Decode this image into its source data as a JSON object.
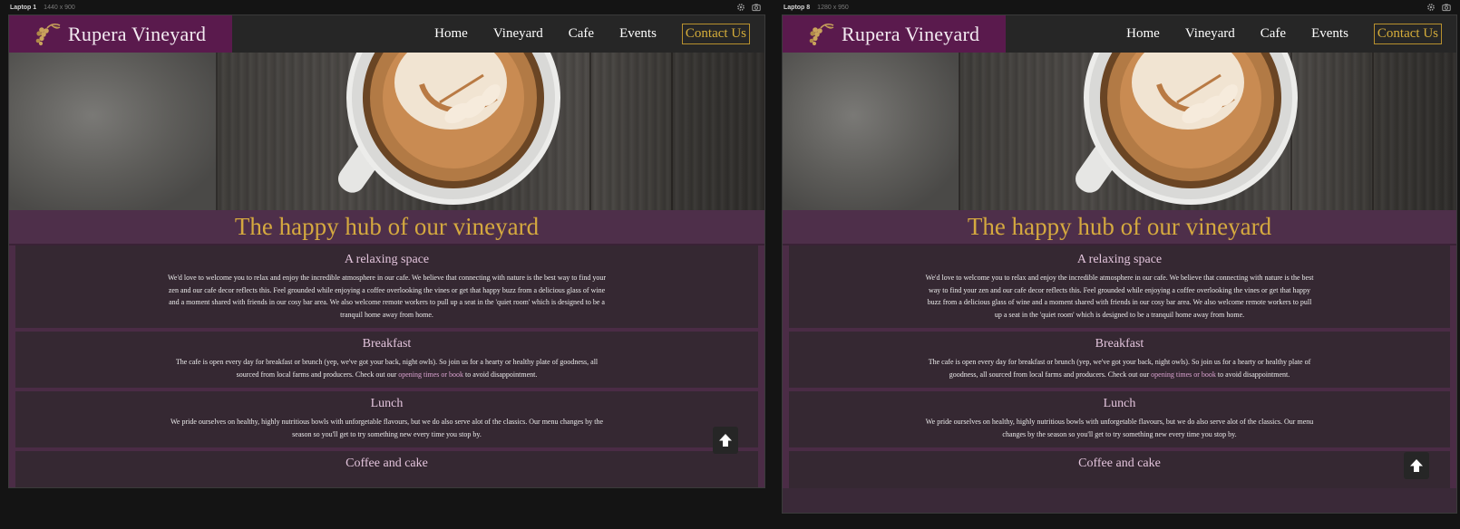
{
  "devices": [
    {
      "label": "Laptop 1",
      "size": "1440 x 900",
      "brand": "Rupera Vineyard",
      "nav": [
        "Home",
        "Vineyard",
        "Cafe",
        "Events"
      ],
      "contact": "Contact Us",
      "page_title": "The happy hub of our vineyard",
      "sections": [
        {
          "title": "A relaxing space",
          "text": "We'd love to welcome you to relax and enjoy the incredible atmosphere in our cafe. We believe that connecting with nature is the best way to find your zen and our cafe decor reflects this. Feel grounded while enjoying a coffee overlooking the vines or get that happy buzz from a delicious glass of wine and a moment shared with friends in our cosy bar area. We also welcome remote workers to pull up a seat in the 'quiet room' which is designed to be a tranquil home away from home."
        },
        {
          "title": "Breakfast",
          "text_before": "The cafe is open every day for breakfast or brunch (yep, we've got your back, night owls). So join us for a hearty or healthy plate of goodness, all sourced from local farms and producers. Check out our ",
          "link": "opening times or book",
          "text_after": " to avoid disappointment."
        },
        {
          "title": "Lunch",
          "text": "We pride ourselves on healthy, highly nutritious bowls with unforgetable flavours, but we do also serve alot of the classics. Our menu changes by the season so you'll get to try something new every time you stop by."
        },
        {
          "title": "Coffee and cake"
        }
      ]
    },
    {
      "label": "Laptop 8",
      "size": "1280 x 950",
      "brand": "Rupera Vineyard",
      "nav": [
        "Home",
        "Vineyard",
        "Cafe",
        "Events"
      ],
      "contact": "Contact Us",
      "page_title": "The happy hub of our vineyard",
      "sections": [
        {
          "title": "A relaxing space",
          "text": "We'd love to welcome you to relax and enjoy the incredible atmosphere in our cafe. We believe that connecting with nature is the best way to find your zen and our cafe decor reflects this. Feel grounded while enjoying a coffee overlooking the vines or get that happy buzz from a delicious glass of wine and a moment shared with friends in our cosy bar area. We also welcome remote workers to pull up a seat in the 'quiet room' which is designed to be a tranquil home away from home."
        },
        {
          "title": "Breakfast",
          "text_before": "The cafe is open every day for breakfast or brunch (yep, we've got your back, night owls). So join us for a hearty or healthy plate of goodness, all sourced from local farms and producers. Check out our ",
          "link": "opening times or book",
          "text_after": " to avoid disappointment."
        },
        {
          "title": "Lunch",
          "text": "We pride ourselves on healthy, highly nutritious bowls with unforgetable flavours, but we do also serve alot of the classics. Our menu changes by the season so you'll get to try something new every time you stop by."
        },
        {
          "title": "Coffee and cake"
        }
      ]
    }
  ],
  "colors": {
    "brand_bg": "#5a1a4d",
    "title_gold": "#d5a93f",
    "section_heading": "#e3c4dc",
    "link": "#d9a2cf"
  },
  "icons": {
    "toolbar": [
      "gear-icon",
      "camera-icon"
    ],
    "logo": "grapes-icon",
    "scroll": "arrow-up-icon"
  }
}
